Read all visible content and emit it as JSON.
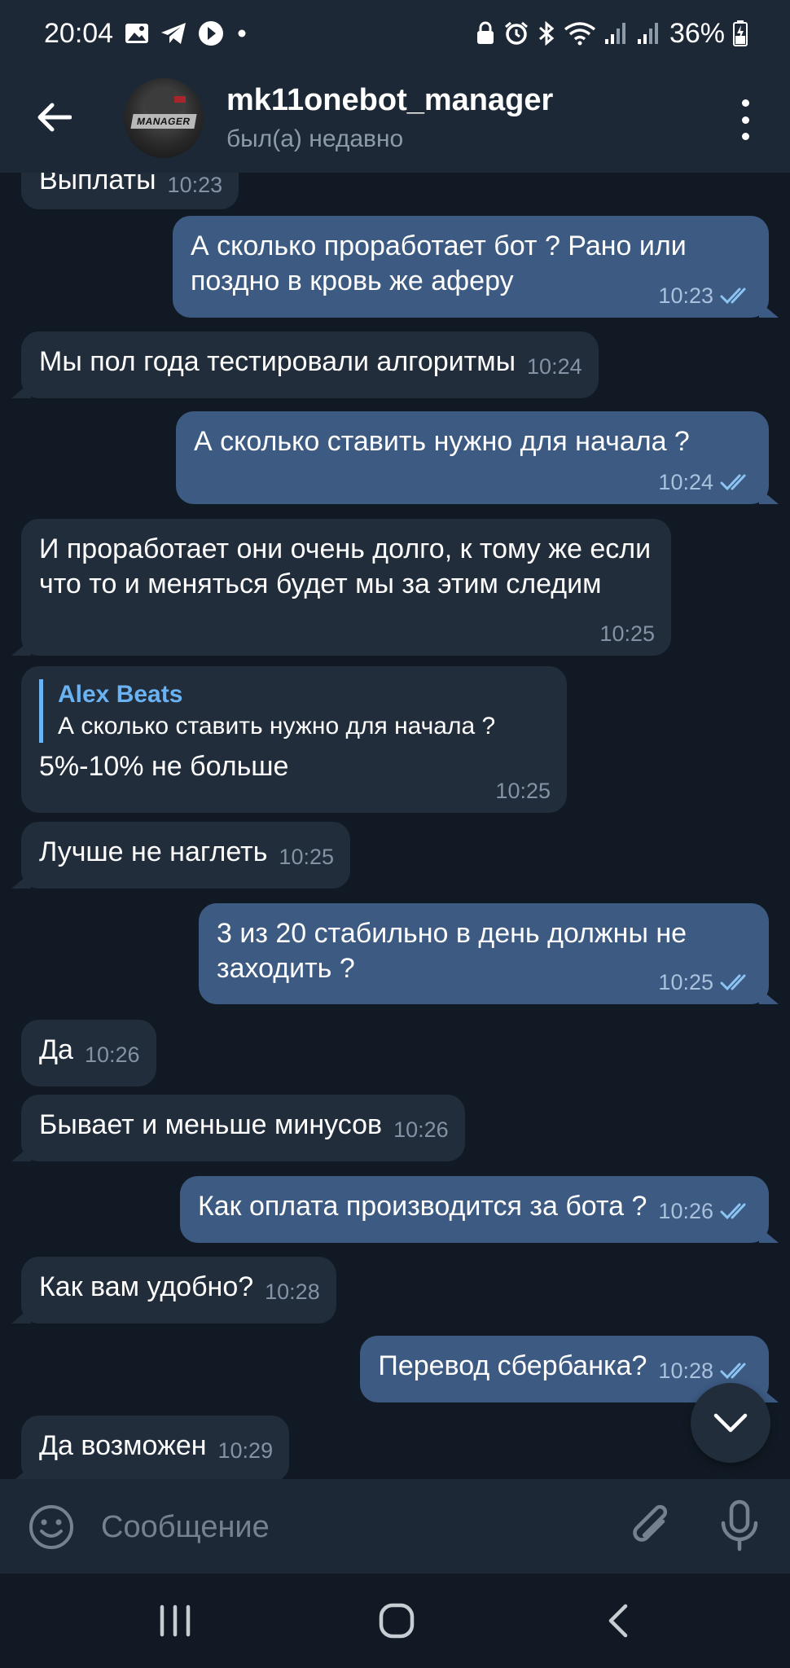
{
  "status_bar": {
    "time": "20:04",
    "battery": "36%",
    "left_icons": [
      "gallery-icon",
      "telegram-icon",
      "play-icon",
      "dot-icon"
    ],
    "right_icons": [
      "lock-icon",
      "alarm-icon",
      "bluetooth-icon",
      "wifi-icon",
      "signal-icon",
      "signal-icon",
      "battery-icon"
    ]
  },
  "header": {
    "title": "mk11onebot_manager",
    "status": "был(а) недавно",
    "avatar_text": "MANAGER"
  },
  "messages": [
    {
      "dir": "in",
      "text": "Выплаты",
      "time": "10:23"
    },
    {
      "dir": "out",
      "text": "А сколько проработает бот ? Рано или поздно в кровь же аферу",
      "time": "10:23",
      "read": true
    },
    {
      "dir": "in",
      "text": "Мы пол года тестировали алгоритмы",
      "time": "10:24"
    },
    {
      "dir": "out",
      "text": "А сколько ставить нужно для начала ?",
      "time": "10:24",
      "read": true
    },
    {
      "dir": "in",
      "text": "И проработает они очень долго, к тому же если что то и меняться будет мы за этим следим",
      "time": "10:25"
    },
    {
      "dir": "in",
      "reply_name": "Alex Beats",
      "reply_text": "А сколько ставить нужно для начала ?",
      "text": "5%-10% не больше",
      "time": "10:25"
    },
    {
      "dir": "in",
      "text": "Лучше не наглеть",
      "time": "10:25"
    },
    {
      "dir": "out",
      "text": "3 из 20 стабильно в день должны не заходить ?",
      "time": "10:25",
      "read": true
    },
    {
      "dir": "in",
      "text": "Да",
      "time": "10:26"
    },
    {
      "dir": "in",
      "text": "Бывает и меньше минусов",
      "time": "10:26"
    },
    {
      "dir": "out",
      "text": "Как оплата производится за бота ?",
      "time": "10:26",
      "read": true
    },
    {
      "dir": "in",
      "text": "Как вам удобно?",
      "time": "10:28"
    },
    {
      "dir": "out",
      "text": "Перевод сбербанка?",
      "time": "10:28",
      "read": true
    },
    {
      "dir": "in",
      "text": "Да возможен",
      "time": "10:29"
    }
  ],
  "composer": {
    "placeholder": "Сообщение"
  },
  "colors": {
    "background": "#111a24",
    "header": "#1c2835",
    "incoming_bubble": "#212d3b",
    "outgoing_bubble": "#3c5a82",
    "accent": "#6ab2f2"
  }
}
